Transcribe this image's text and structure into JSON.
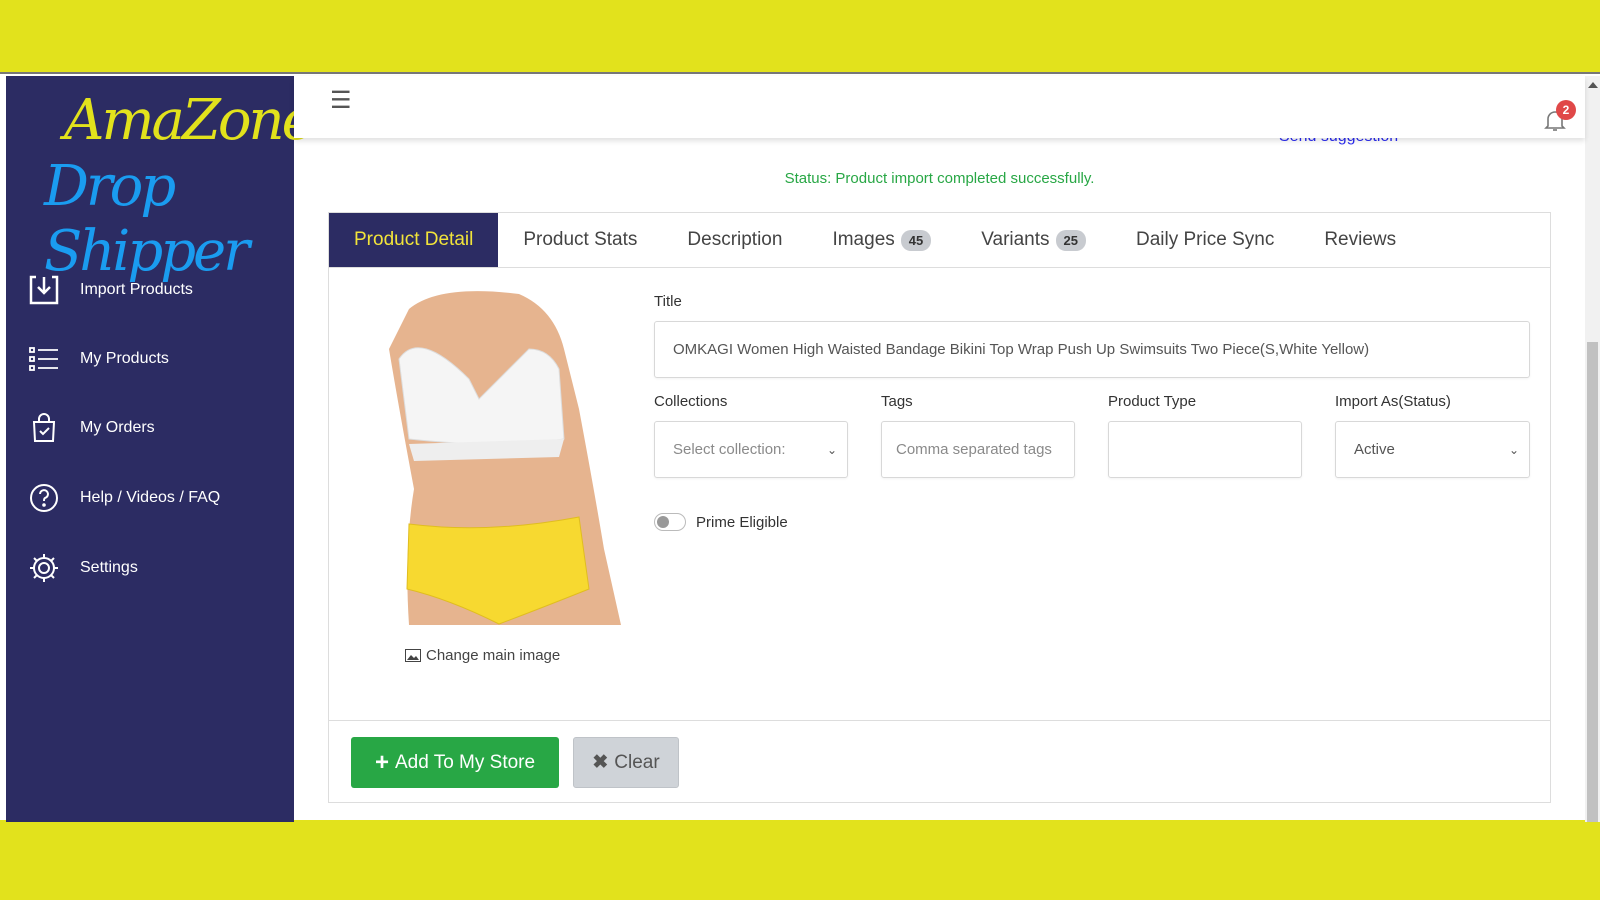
{
  "logo": {
    "line1": "AmaZone",
    "line2": "Drop Shipper"
  },
  "sidebar": {
    "items": [
      {
        "label": "Import Products",
        "icon": "import-icon"
      },
      {
        "label": "My Products",
        "icon": "list-icon"
      },
      {
        "label": "My Orders",
        "icon": "shopping-bag-icon"
      },
      {
        "label": "Help / Videos / FAQ",
        "icon": "help-icon"
      },
      {
        "label": "Settings",
        "icon": "gear-icon"
      }
    ]
  },
  "header": {
    "notification_count": "2",
    "send_suggestion": "Send suggestion"
  },
  "status": "Status: Product import completed successfully.",
  "tabs": [
    {
      "label": "Product Detail",
      "active": true
    },
    {
      "label": "Product Stats"
    },
    {
      "label": "Description"
    },
    {
      "label": "Images",
      "badge": "45"
    },
    {
      "label": "Variants",
      "badge": "25"
    },
    {
      "label": "Daily Price Sync"
    },
    {
      "label": "Reviews"
    }
  ],
  "form": {
    "title_label": "Title",
    "title_value": "OMKAGI Women High Waisted Bandage Bikini Top Wrap Push Up Swimsuits Two Piece(S,White Yellow)",
    "collections_label": "Collections",
    "collections_placeholder": "Select collection:",
    "tags_label": "Tags",
    "tags_placeholder": "Comma separated tags",
    "type_label": "Product Type",
    "type_value": "",
    "status_label": "Import As(Status)",
    "status_value": "Active",
    "prime_label": "Prime Eligible",
    "prime_on": false,
    "change_image": "Change main image"
  },
  "actions": {
    "add": "Add To My Store",
    "clear": "Clear"
  },
  "colors": {
    "sidebar": "#2c2c63",
    "accent": "#f2e43a",
    "success": "#28a745",
    "frame": "#e2e21c"
  }
}
